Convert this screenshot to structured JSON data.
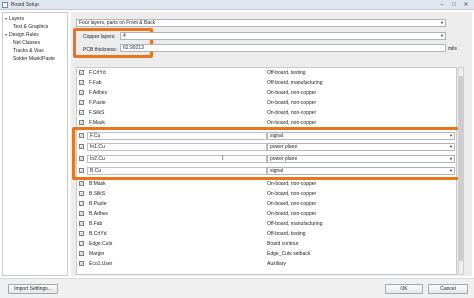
{
  "window": {
    "title": "Board Setup",
    "minimize": "–",
    "maximize": "□",
    "close": "✕"
  },
  "tree": {
    "items": [
      {
        "label": "Layers",
        "expander": "▾"
      },
      {
        "label": "Text & Graphics"
      },
      {
        "label": "Design Rules",
        "expander": "▾"
      },
      {
        "label": "Net Classes"
      },
      {
        "label": "Tracks & Vias"
      },
      {
        "label": "Solder Mask/Paste"
      }
    ]
  },
  "preset": {
    "value": "Four layers, parts on Front & Back",
    "arrow": "▼"
  },
  "copper_layers": {
    "label": "Copper layers:",
    "value": "4",
    "arrow": "▼"
  },
  "pcb_thickness": {
    "label": "PCB thickness:",
    "value": "62.99213",
    "unit": "mils"
  },
  "highlight_color": "#e8761e",
  "layers_top": [
    {
      "checked": true,
      "name": "F.CrtYd",
      "desc": "Off-board, testing"
    },
    {
      "checked": true,
      "name": "F.Fab",
      "desc": "Off-board, manufacturing"
    },
    {
      "checked": true,
      "name": "F.Adhes",
      "desc": "On-board, non-copper"
    },
    {
      "checked": true,
      "name": "F.Paste",
      "desc": "On-board, non-copper"
    },
    {
      "checked": true,
      "name": "F.SilkS",
      "desc": "On-board, non-copper"
    },
    {
      "checked": true,
      "name": "F.Mask",
      "desc": "On-board, non-copper"
    }
  ],
  "copper_rows": [
    {
      "checked": true,
      "name": "F.Cu",
      "type": "signal"
    },
    {
      "checked": true,
      "name": "In1.Cu",
      "type": "power plane"
    },
    {
      "checked": true,
      "name": "In2.Cu",
      "type": "power plane"
    },
    {
      "checked": true,
      "name": "B.Cu",
      "type": "signal"
    }
  ],
  "layers_bottom": [
    {
      "checked": true,
      "name": "B.Mask",
      "desc": "On-board, non-copper"
    },
    {
      "checked": true,
      "name": "B.SilkS",
      "desc": "On-board, non-copper"
    },
    {
      "checked": true,
      "name": "B.Paste",
      "desc": "On-board, non-copper"
    },
    {
      "checked": true,
      "name": "B.Adhes",
      "desc": "On-board, non-copper"
    },
    {
      "checked": true,
      "name": "B.Fab",
      "desc": "Off-board, manufacturing"
    },
    {
      "checked": true,
      "name": "B.CrtYd",
      "desc": "Off-board, testing"
    },
    {
      "checked": true,
      "name": "Edge.Cuts",
      "desc": "Board contour"
    },
    {
      "checked": true,
      "name": "Margin",
      "desc": "Edge_Cuts setback"
    },
    {
      "checked": true,
      "name": "Eco1.User",
      "desc": "Auxiliary"
    }
  ],
  "check_glyph": "✓",
  "cursor_glyph": "I",
  "footer": {
    "import_label": "Import Settings...",
    "ok_label": "OK",
    "cancel_label": "Cancel"
  }
}
